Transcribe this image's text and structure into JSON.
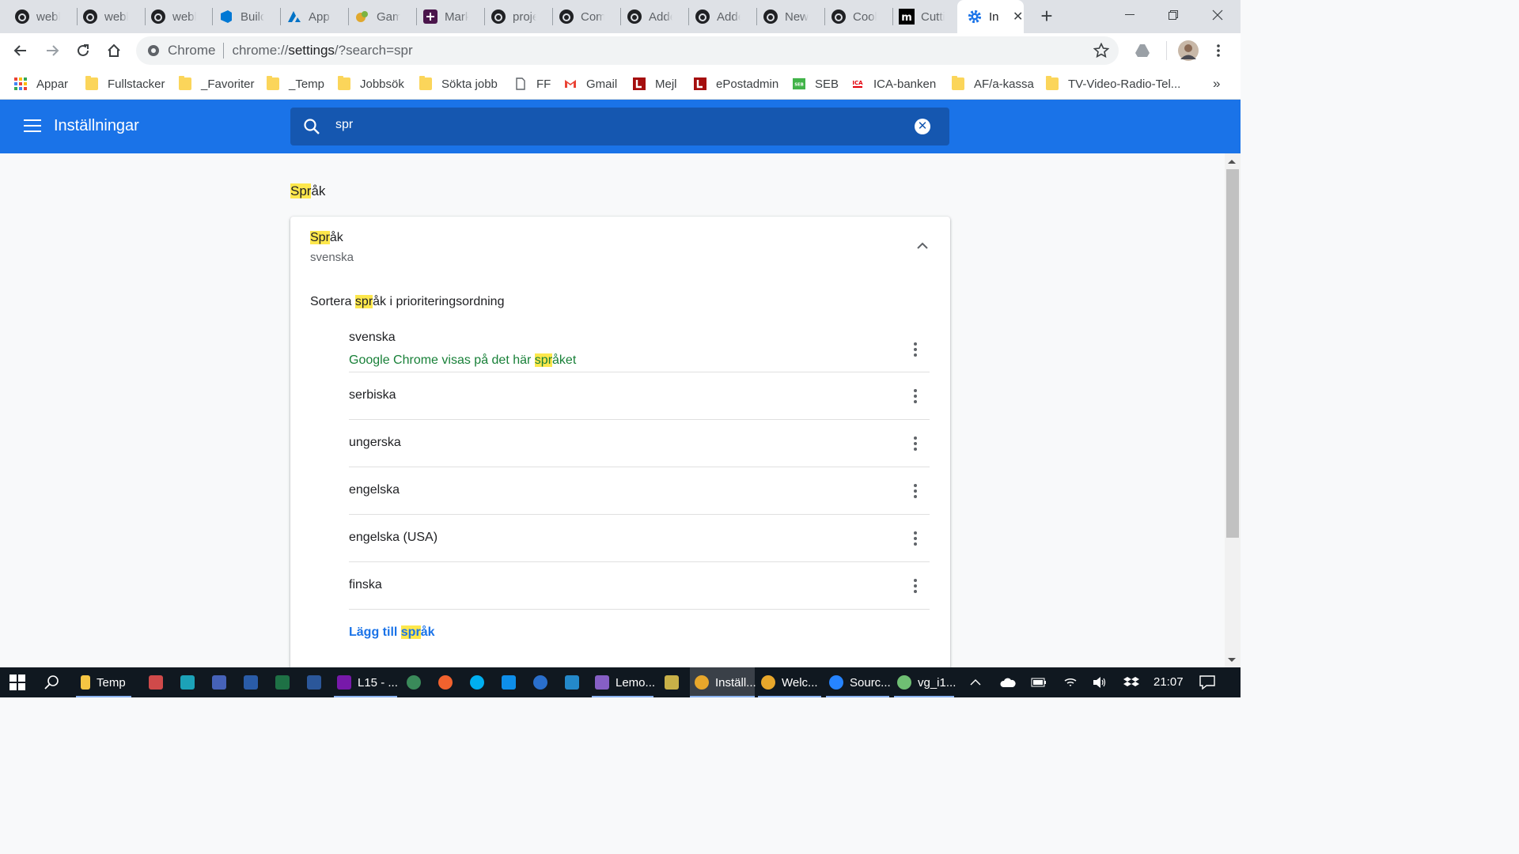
{
  "tabs": [
    {
      "label": "webb",
      "icon": "github-icon"
    },
    {
      "label": "webb",
      "icon": "github-icon"
    },
    {
      "label": "webb",
      "icon": "github-icon"
    },
    {
      "label": "Builds",
      "icon": "azure-devops-icon"
    },
    {
      "label": "App S",
      "icon": "azure-icon"
    },
    {
      "label": "Game",
      "icon": "game-icon"
    },
    {
      "label": "Marks",
      "icon": "slack-icon"
    },
    {
      "label": "proje",
      "icon": "github-icon"
    },
    {
      "label": "Comp",
      "icon": "github-icon"
    },
    {
      "label": "Adde",
      "icon": "github-icon"
    },
    {
      "label": "Adde",
      "icon": "github-icon"
    },
    {
      "label": "New",
      "icon": "github-icon"
    },
    {
      "label": "Cook",
      "icon": "github-icon"
    },
    {
      "label": "Cuttir",
      "icon": "medium-icon"
    },
    {
      "label": "In",
      "icon": "settings-gear-icon",
      "active": true
    }
  ],
  "omnibox": {
    "site_label": "Chrome",
    "url_prefix": "chrome://",
    "url_host": "settings",
    "url_rest": "/?search=spr"
  },
  "bookmarks": [
    {
      "label": "Appar",
      "icon": "apps-grid-icon"
    },
    {
      "label": "Fullstacker",
      "icon": "folder-icon"
    },
    {
      "label": "_Favoriter",
      "icon": "folder-icon"
    },
    {
      "label": "_Temp",
      "icon": "folder-icon"
    },
    {
      "label": "Jobbsök",
      "icon": "folder-icon"
    },
    {
      "label": "Sökta jobb",
      "icon": "folder-icon"
    },
    {
      "label": "FF",
      "icon": "page-icon"
    },
    {
      "label": "Gmail",
      "icon": "gmail-icon"
    },
    {
      "label": "Mejl",
      "icon": "l-logo-icon"
    },
    {
      "label": "ePostadmin",
      "icon": "l-logo-icon"
    },
    {
      "label": "SEB",
      "icon": "seb-icon"
    },
    {
      "label": "ICA-banken",
      "icon": "ica-icon"
    },
    {
      "label": "AF/a-kassa",
      "icon": "folder-icon"
    },
    {
      "label": "TV-Video-Radio-Tel...",
      "icon": "folder-icon"
    }
  ],
  "bookmarks_more": "»",
  "header": {
    "title": "Inställningar",
    "search_value": "spr"
  },
  "search_highlight": "spr",
  "section": {
    "title_hl": "Spr",
    "title_rest": "åk"
  },
  "card": {
    "title_hl": "Spr",
    "title_rest": "åk",
    "subtitle": "svenska",
    "sort_before": "Sortera ",
    "sort_hl": "spr",
    "sort_after": "åk i prioriteringsordning",
    "languages": [
      {
        "name": "svenska",
        "note_before": "Google Chrome visas på det här ",
        "note_hl": "spr",
        "note_after": "åket"
      },
      {
        "name": "serbiska"
      },
      {
        "name": "ungerska"
      },
      {
        "name": "engelska"
      },
      {
        "name": "engelska (USA)"
      },
      {
        "name": "finska"
      }
    ],
    "add_before": "Lägg till ",
    "add_hl": "spr",
    "add_after": "åk"
  },
  "taskbar": {
    "items": [
      {
        "label": "Temp",
        "icon": "file-explorer-icon"
      },
      {
        "label": "L15 - ...",
        "icon": "onenote-icon"
      },
      {
        "label": "Lemo...",
        "icon": "visual-studio-icon"
      },
      {
        "label": "Inställ...",
        "icon": "chrome-icon",
        "active": true
      },
      {
        "label": "Welc...",
        "icon": "chrome-icon"
      },
      {
        "label": "Sourc...",
        "icon": "sourcetree-icon"
      },
      {
        "label": "vg_i1...",
        "icon": "chrome-app-icon"
      }
    ],
    "clock": "21:07"
  },
  "colors": {
    "accent": "#1a73e8",
    "search_bg": "#1557b0",
    "highlight": "#fde74c",
    "note_green": "#188038"
  }
}
